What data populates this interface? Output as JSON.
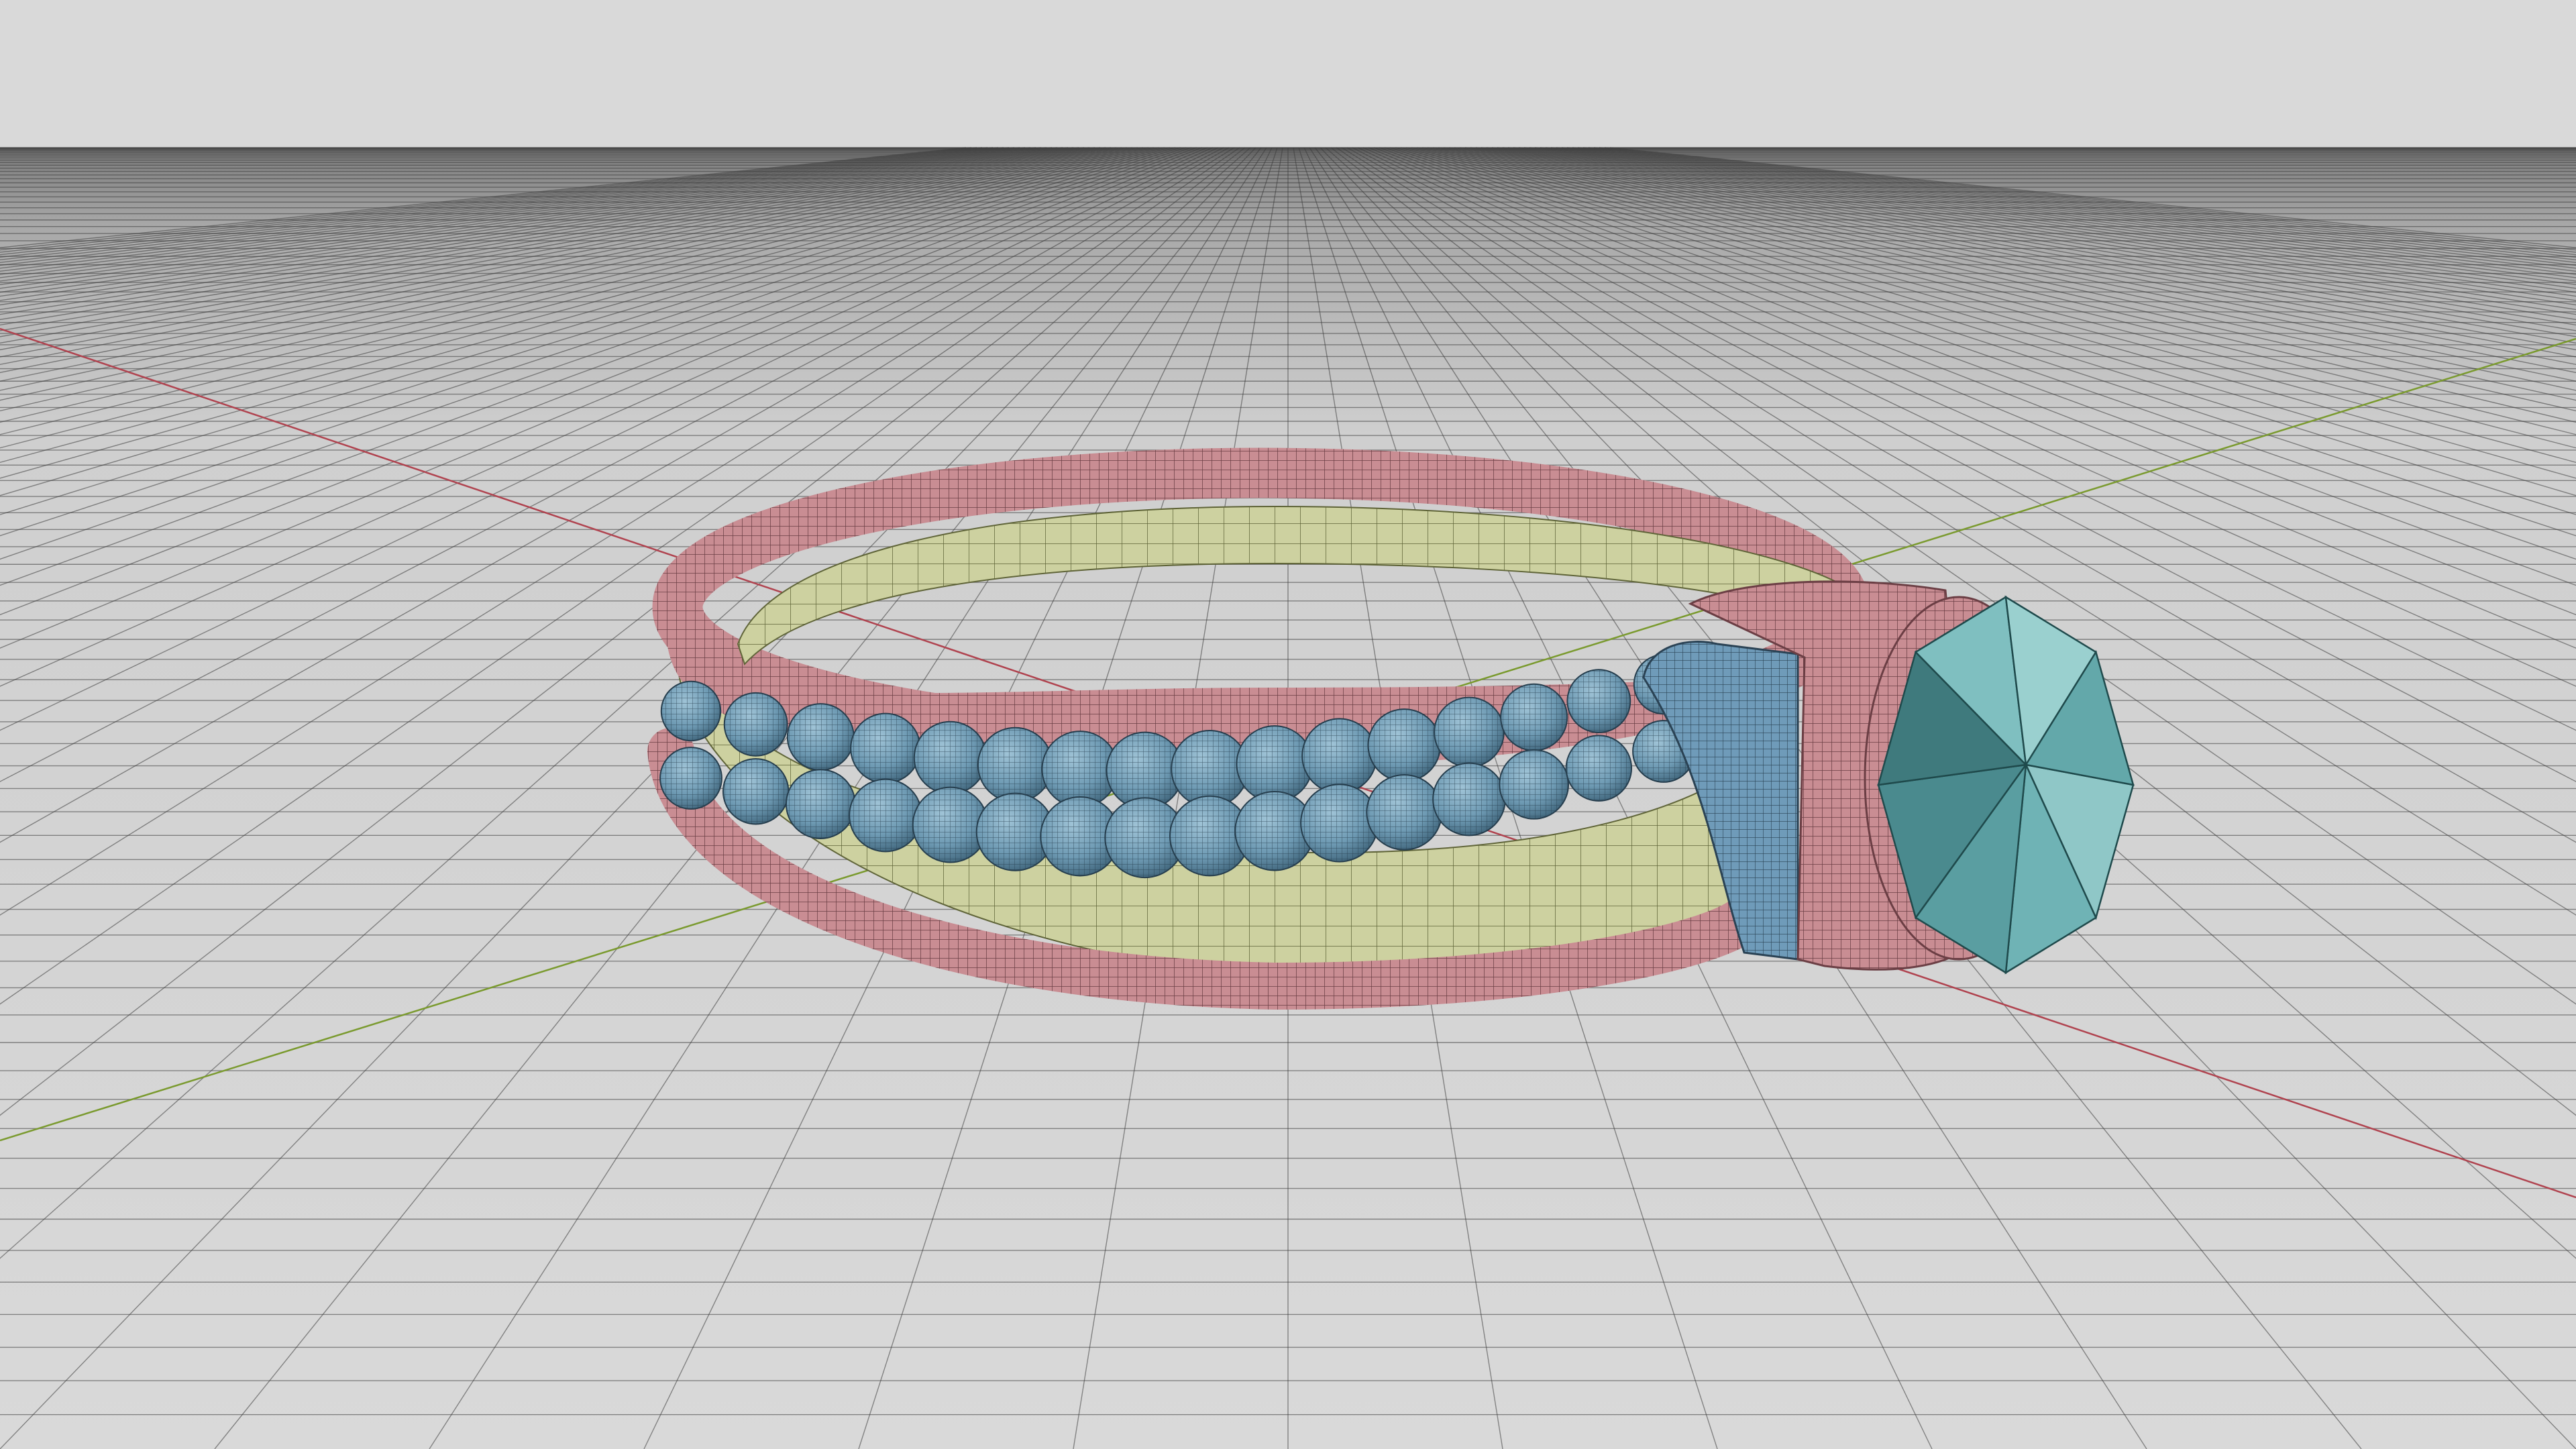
{
  "viewport": {
    "name": "3d-viewport",
    "background_color": "#d9d9d9",
    "floor_color": "#d8d8d8",
    "horizon_color": "#808080",
    "grid_line_color": "#3c3c3c",
    "x_axis_color": "#b0434f",
    "y_axis_color": "#7a9a2e",
    "display_mode": "shaded-wireframe"
  },
  "scene": {
    "object": "ring",
    "parts": [
      {
        "name": "band-rails",
        "color": "#c98d93",
        "wire": "#6b3e44"
      },
      {
        "name": "inner-band",
        "color": "#cdd1a0",
        "wire": "#5f6438"
      },
      {
        "name": "bead-rows",
        "color": "#6e9ab3",
        "wire": "#263e4e",
        "rows": 2
      },
      {
        "name": "setting-bezel",
        "color": "#c98d93",
        "wire": "#6b3e44"
      },
      {
        "name": "side-plate",
        "color": "#6f9bb9",
        "wire": "#2a4254"
      },
      {
        "name": "gemstone",
        "color": "#6fb3b5",
        "wire": "#1f4a4c"
      }
    ]
  }
}
